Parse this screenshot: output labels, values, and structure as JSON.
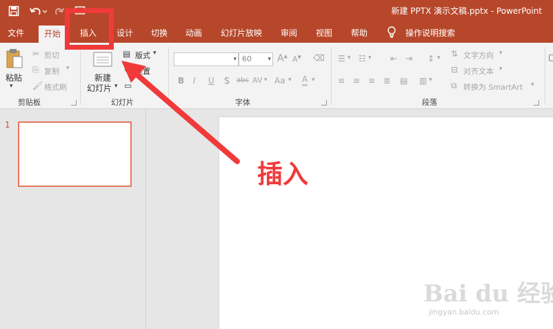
{
  "window": {
    "doc_title": "新建 PPTX 演示文稿.pptx  -  PowerPoint",
    "quick_access": {
      "save_icon": "save-icon",
      "undo_icon": "undo-icon",
      "redo_icon": "redo-icon",
      "slideshow_icon": "start-from-beginning-icon"
    }
  },
  "tabs": {
    "file": "文件",
    "home": "开始",
    "insert": "插入",
    "design": "设计",
    "transitions": "切换",
    "animations": "动画",
    "slideshow": "幻灯片放映",
    "review": "审阅",
    "view": "视图",
    "help": "帮助",
    "tell_me": "操作说明搜索",
    "active": "开始"
  },
  "ribbon": {
    "clipboard": {
      "paste": "粘贴",
      "cut": "剪切",
      "copy": "复制",
      "format_painter": "格式刷",
      "label": "剪贴板"
    },
    "slides": {
      "new_slide_1": "新建",
      "new_slide_2": "幻灯片",
      "layout": "版式",
      "reset": "重置",
      "label": "幻灯片"
    },
    "font": {
      "font_name": "",
      "font_size": "60",
      "bold": "B",
      "italic": "I",
      "underline": "U",
      "shadow": "S",
      "strikethrough": "abc",
      "char_spacing": "AV",
      "change_case": "Aa",
      "font_color": "A",
      "grow": "A",
      "shrink": "A",
      "label": "字体"
    },
    "paragraph": {
      "text_direction": "文字方向",
      "align_text": "对齐文本",
      "convert_smartart": "转换为 SmartArt",
      "label": "段落"
    }
  },
  "slides_panel": {
    "slide_number": "1"
  },
  "annotation": {
    "text": "插入",
    "color": "#f03a3a"
  },
  "watermark": {
    "logo": "Bai du 经验",
    "url": "jingyan.baidu.com"
  },
  "colors": {
    "accent": "#b7472a",
    "ribbon_bg": "#f3f3f3",
    "panel_bg": "#e6e6e6",
    "thumb_border": "#e8765c"
  }
}
